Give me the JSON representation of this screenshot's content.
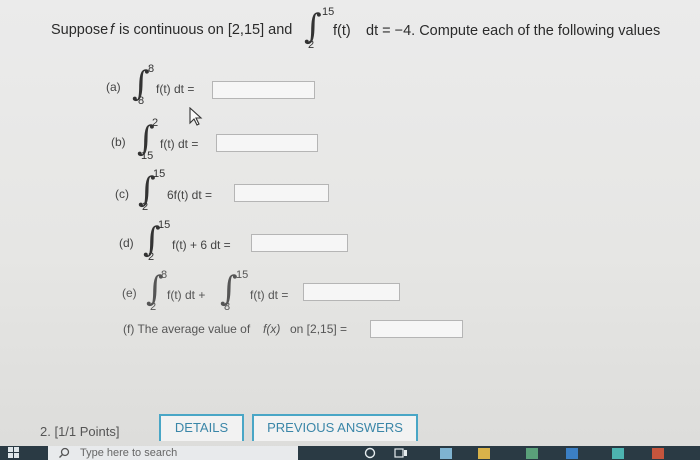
{
  "statement": {
    "prefix": "Suppose",
    "f": "f",
    "mid": "is continuous on [2,15] and",
    "int_upper": "15",
    "int_lower": "2",
    "integrand": "f(t)",
    "dt_eq": "dt = −4. Compute each of the following values"
  },
  "parts": {
    "a": {
      "label": "(a)",
      "upper": "8",
      "lower": "8",
      "expr": "f(t) dt ="
    },
    "b": {
      "label": "(b)",
      "upper": "2",
      "lower": "15",
      "expr": "f(t) dt ="
    },
    "c": {
      "label": "(c)",
      "upper": "15",
      "lower": "2",
      "expr": "6f(t) dt ="
    },
    "d": {
      "label": "(d)",
      "upper": "15",
      "lower": "2",
      "expr": "f(t) + 6 dt ="
    },
    "e": {
      "label": "(e)",
      "upper1": "8",
      "lower1": "2",
      "expr1": "f(t) dt +",
      "upper2": "15",
      "lower2": "8",
      "expr2": "f(t) dt ="
    },
    "f": {
      "text_before": "(f) The average value of",
      "fx": "f(x)",
      "text_after": "on [2,15] ="
    }
  },
  "question": {
    "label": "2.  [1/1 Points]",
    "details_button": "DETAILS",
    "previous_answers_button": "PREVIOUS ANSWERS"
  },
  "taskbar": {
    "search_placeholder": "Type here to search"
  },
  "colors": {
    "button_border": "#49a6c6",
    "taskbar": "#2a3a44"
  }
}
